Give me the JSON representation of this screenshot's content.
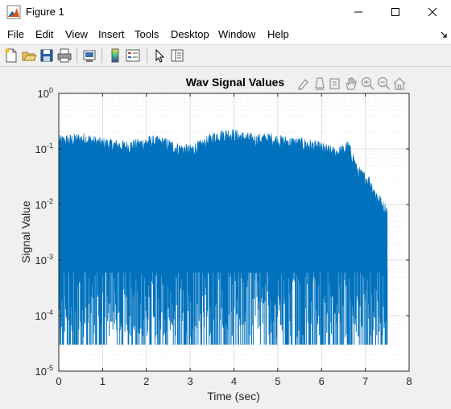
{
  "window": {
    "title": "Figure 1"
  },
  "menu": {
    "items": [
      "File",
      "Edit",
      "View",
      "Insert",
      "Tools",
      "Desktop",
      "Window",
      "Help"
    ]
  },
  "toolbar": {
    "icons": [
      "new-figure-icon",
      "open-file-icon",
      "save-icon",
      "print-icon",
      "link-plot-icon",
      "insert-colorbar-icon",
      "insert-legend-icon",
      "pointer-icon",
      "property-inspector-icon"
    ]
  },
  "axes_toolbar": {
    "icons": [
      "brush-icon",
      "data-tips-icon",
      "rotate-icon",
      "pan-icon",
      "zoom-in-icon",
      "zoom-out-icon",
      "home-icon"
    ]
  },
  "colors": {
    "signal": "#0072bd",
    "axes_bg": "#ffffff",
    "figure_bg": "#f0f0f0"
  },
  "chart_data": {
    "type": "line",
    "title": "Wav Signal Values",
    "xlabel": "Time (sec)",
    "ylabel": "Signal Value",
    "xlim": [
      0,
      8
    ],
    "ylim": [
      1e-05,
      1
    ],
    "yscale": "log",
    "grid": true,
    "xticks": [
      "0",
      "1",
      "2",
      "3",
      "4",
      "5",
      "6",
      "7",
      "8"
    ],
    "yticks": [
      {
        "base": "10",
        "exp": "0"
      },
      {
        "base": "10",
        "exp": "-1"
      },
      {
        "base": "10",
        "exp": "-2"
      },
      {
        "base": "10",
        "exp": "-3"
      },
      {
        "base": "10",
        "exp": "-4"
      },
      {
        "base": "10",
        "exp": "-5"
      }
    ],
    "series": [
      {
        "signal_end_time": 7.5,
        "floor_value": 3e-05,
        "envelope": {
          "x": [
            0,
            0.3,
            0.6,
            0.9,
            1.2,
            1.5,
            1.8,
            2.1,
            2.4,
            2.7,
            3.0,
            3.3,
            3.6,
            3.9,
            4.2,
            4.5,
            4.8,
            5.1,
            5.4,
            5.7,
            6.0,
            6.3,
            6.5,
            6.6,
            6.7,
            6.8,
            6.9,
            7.0,
            7.1,
            7.2,
            7.3,
            7.4,
            7.5
          ],
          "y": [
            0.16,
            0.17,
            0.18,
            0.15,
            0.14,
            0.13,
            0.14,
            0.16,
            0.15,
            0.12,
            0.11,
            0.14,
            0.2,
            0.22,
            0.19,
            0.17,
            0.18,
            0.16,
            0.15,
            0.14,
            0.12,
            0.1,
            0.11,
            0.13,
            0.09,
            0.05,
            0.04,
            0.035,
            0.03,
            0.02,
            0.015,
            0.011,
            0.009
          ]
        }
      }
    ]
  }
}
